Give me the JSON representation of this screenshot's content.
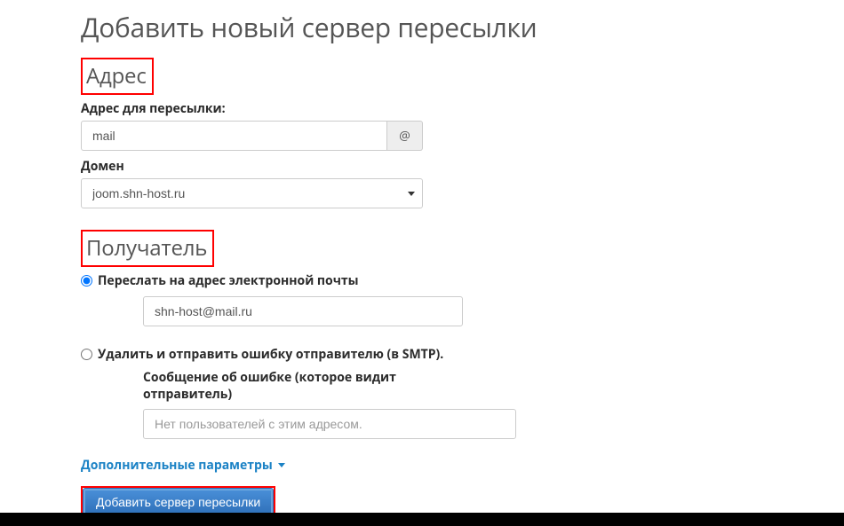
{
  "page": {
    "title": "Добавить новый сервер пересылки"
  },
  "address": {
    "heading": "Адрес",
    "forward_label": "Адрес для пересылки:",
    "forward_value": "mail",
    "at": "@",
    "domain_label": "Домен",
    "domain_value": "joom.shn-host.ru"
  },
  "recipient": {
    "heading": "Получатель",
    "option_forward": "Переслать на адрес электронной почты",
    "forward_email_value": "shn-host@mail.ru",
    "option_discard": "Удалить и отправить ошибку отправителю (в SMTP).",
    "error_msg_label": "Сообщение об ошибке (которое видит отправитель)",
    "error_msg_placeholder": "Нет пользователей с этим адресом."
  },
  "more": {
    "label": "Дополнительные параметры"
  },
  "submit": {
    "label": "Добавить сервер пересылки"
  }
}
